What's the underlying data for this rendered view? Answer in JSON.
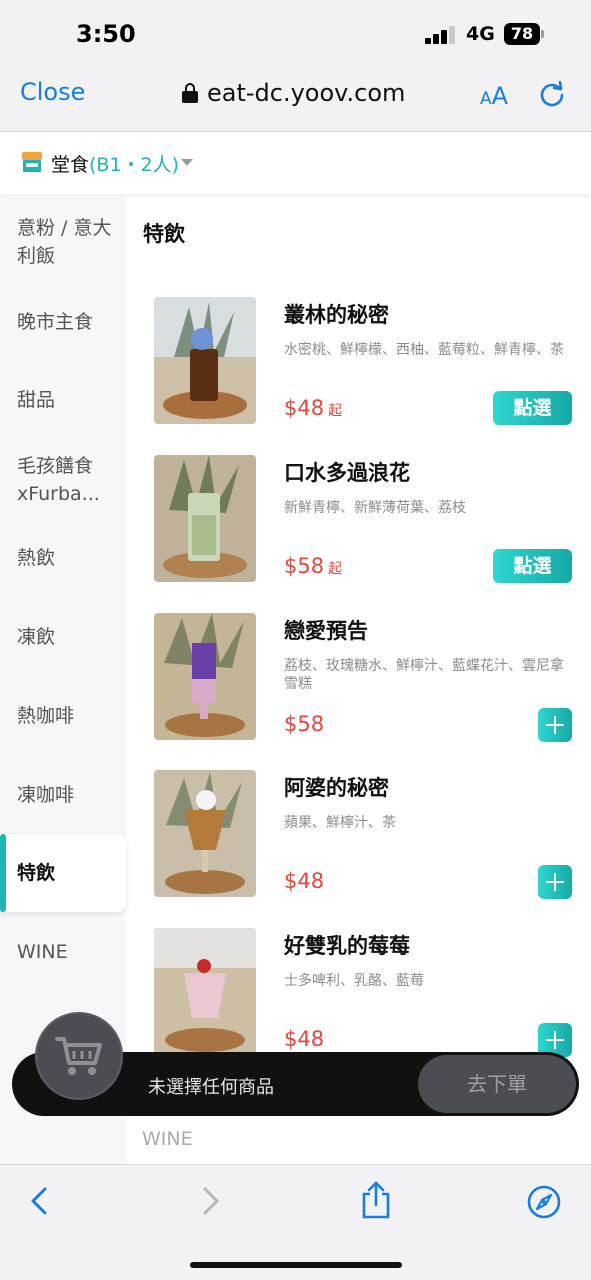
{
  "status_bar": {
    "time": "3:50",
    "network": "4G",
    "battery": "78"
  },
  "browser": {
    "close_label": "Close",
    "url": "eat-dc.yoov.com",
    "text_size_small": "A",
    "text_size_large": "A"
  },
  "order_bar": {
    "type": "堂食",
    "detail": "(B1・2人)"
  },
  "sidebar": {
    "categories": [
      {
        "label": "意粉 / 意大利飯"
      },
      {
        "label": "晚市主食"
      },
      {
        "label": "甜品"
      },
      {
        "label": "毛孩饍食xFurba..."
      },
      {
        "label": "熱飲"
      },
      {
        "label": "凍飲"
      },
      {
        "label": "熱咖啡"
      },
      {
        "label": "凍咖啡"
      },
      {
        "label": "特飲",
        "active": true
      },
      {
        "label": "WINE"
      }
    ]
  },
  "main": {
    "section_title": "特飲",
    "items": [
      {
        "name": "叢林的秘密",
        "desc": "水密桃、鮮檸檬、西柚、藍莓粒、鮮青檸、茶",
        "price": "$48",
        "price_suffix": "起",
        "action": "點選"
      },
      {
        "name": "口水多過浪花",
        "desc": "新鮮青檸、新鮮薄荷葉、荔枝",
        "price": "$58",
        "price_suffix": "起",
        "action": "點選"
      },
      {
        "name": "戀愛預告",
        "desc": "荔枝、玫瑰糖水、鮮檸汁、藍蝶花汁、雲尼拿雪糕",
        "price": "$58",
        "price_suffix": "",
        "action": "+"
      },
      {
        "name": "阿婆的秘密",
        "desc": "蘋果、鮮檸汁、茶",
        "price": "$48",
        "price_suffix": "",
        "action": "+"
      },
      {
        "name": "好雙乳的莓莓",
        "desc": "士多啤利、乳酪、藍莓",
        "price": "$48",
        "price_suffix": "",
        "action": "+"
      }
    ],
    "next_section": "WINE"
  },
  "cart": {
    "status": "未選擇任何商品",
    "checkout_label": "去下單"
  },
  "colors": {
    "accent": "#1fb5b3",
    "price": "#e8453c",
    "link": "#1a7ce0"
  }
}
